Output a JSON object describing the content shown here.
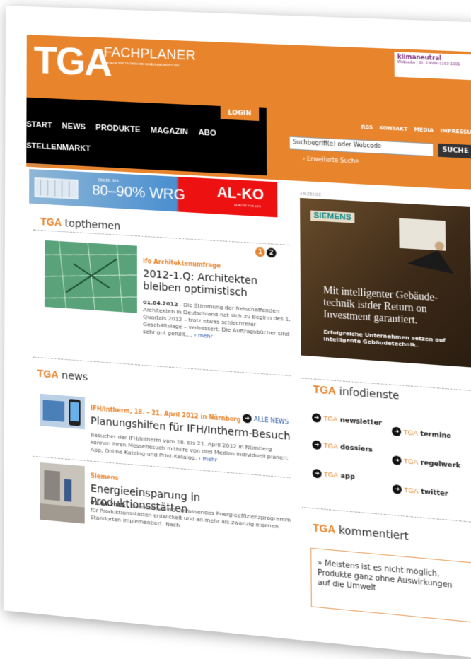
{
  "header": {
    "logo": "TGA",
    "logo_sub": "FACHPLANER",
    "logo_tag": "MAGAZIN FÜR TECHNISCHE GEBÄUDEAUSRÜSTUNG",
    "climate_line1": "klimaneutral",
    "climate_line2": "Webseite | ID: 53686-1203-1001",
    "login": "LOGIN",
    "nav": [
      "START",
      "NEWS",
      "PRODUKTE",
      "MAGAZIN",
      "ABO"
    ],
    "nav2": "STELLENMARKT",
    "toplinks": [
      "RSS",
      "KONTAKT",
      "MEDIA",
      "IMPRESSUM"
    ],
    "search_placeholder": "Suchbegriff(e) oder Webcode",
    "search_button": "SUCHE",
    "advanced": "› Erweiterte Suche"
  },
  "ad_left": {
    "label": "ANZEIGE",
    "din": "DIN EN 308",
    "pct": "80–90% WRG",
    "brand": "AL-KO",
    "tagline": "QUALITY FOR LIFE"
  },
  "topthemen": {
    "title_brand": "TGA",
    "title": "topthemen",
    "pages": [
      "1",
      "2"
    ],
    "kicker": "ifo Architektenumfrage",
    "headline": "2012-1.Q: Architekten bleiben optimistisch",
    "date": "01.04.2012",
    "text": " - Die Stimmung der freischaffenden Architekten in Deutschland hat sich zu Beginn des 1. Quartals 2012 – trotz etwas schlechterer Geschäftslage – verbessert. Die Auftragsbücher sind sehr gut gefüllt....",
    "more": "› mehr"
  },
  "news": {
    "title_brand": "TGA",
    "title": "news",
    "all": "ALLE NEWS",
    "items": [
      {
        "kicker": "IFH/Intherm, 18. – 21. April 2012 in Nürnberg",
        "headline": "Planungshilfen für IFH/Intherm-Besuch",
        "text": "Besucher der IFH/Intherm vom 18. bis 21. April 2012 in Nürnberg können ihren Messebesuch mithilfe von drei Medien individuell planen: App, Online-Katalog und Print-Katalog.",
        "more": "› mehr"
      },
      {
        "kicker": "Siemens",
        "headline": "Energieeinsparung in Produktionsstätten",
        "date": "01.04.2012",
        "text": " - Siemens hat ein umfassendes Energieeffizienzprogramm für Produktionsstätten entwickelt und an mehr als zwanzig eigenen Standorten implementiert. Nach"
      }
    ]
  },
  "ad_right": {
    "label": "ANZEIGE",
    "brand": "SIEMENS",
    "big": "Mit intelligenter Gebäude-technik istder Return on Investment garantiert.",
    "small": "Erfolgreiche Unternehmen setzen auf intelligente Gebäudetechnik."
  },
  "infodienste": {
    "title_brand": "TGA",
    "title": "infodienste",
    "brand": "TGA",
    "items": [
      "newsletter",
      "termine",
      "dossiers",
      "regelwerk",
      "app",
      "twitter"
    ]
  },
  "kommentiert": {
    "title_brand": "TGA",
    "title": "kommentiert",
    "text": "» Meistens ist es nicht möglich, Produkte ganz ohne Auswirkungen auf die Umwelt"
  }
}
